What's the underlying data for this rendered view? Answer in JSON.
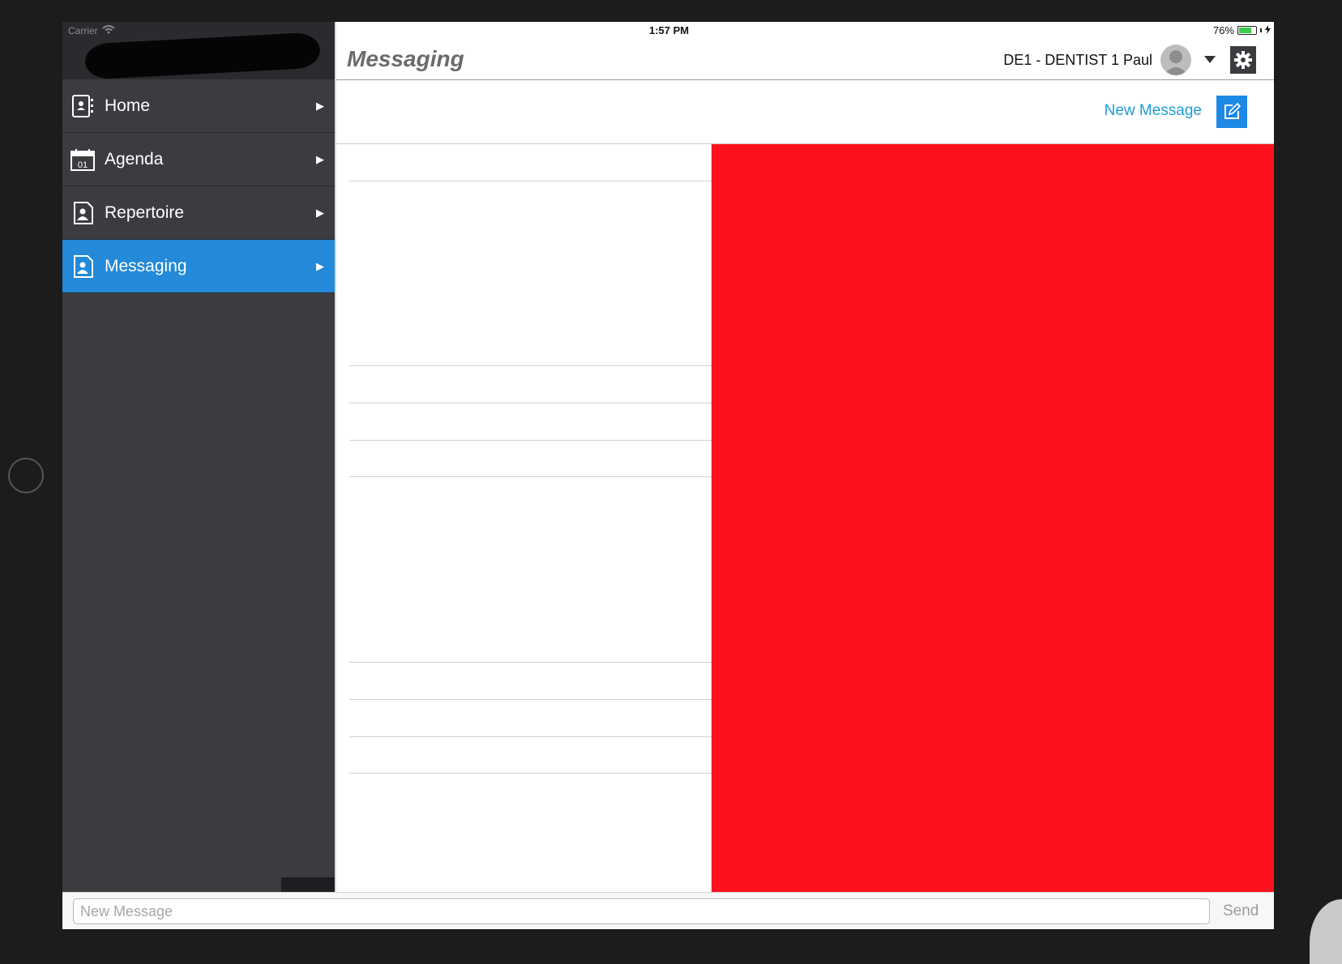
{
  "status_bar": {
    "carrier": "Carrier",
    "time": "1:57 PM",
    "battery": "76%",
    "battery_level": 0.76
  },
  "header": {
    "title": "Messaging",
    "user_name": "DE1 - DENTIST 1 Paul"
  },
  "sidebar": {
    "items": [
      {
        "label": "Home",
        "icon": "contacts-icon",
        "active": false
      },
      {
        "label": "Agenda",
        "icon": "calendar-icon",
        "calendar_day": "01",
        "active": false
      },
      {
        "label": "Repertoire",
        "icon": "person-document-icon",
        "active": false
      },
      {
        "label": "Messaging",
        "icon": "person-document-icon",
        "active": true
      }
    ]
  },
  "toolbar": {
    "new_message_label": "New Message"
  },
  "compose": {
    "placeholder": "New Message",
    "send_label": "Send"
  },
  "colors": {
    "accent": "#2389d8",
    "link": "#1f9bd6",
    "detail_panel": "#fd111d",
    "sidebar_bg": "#3c3b40"
  }
}
